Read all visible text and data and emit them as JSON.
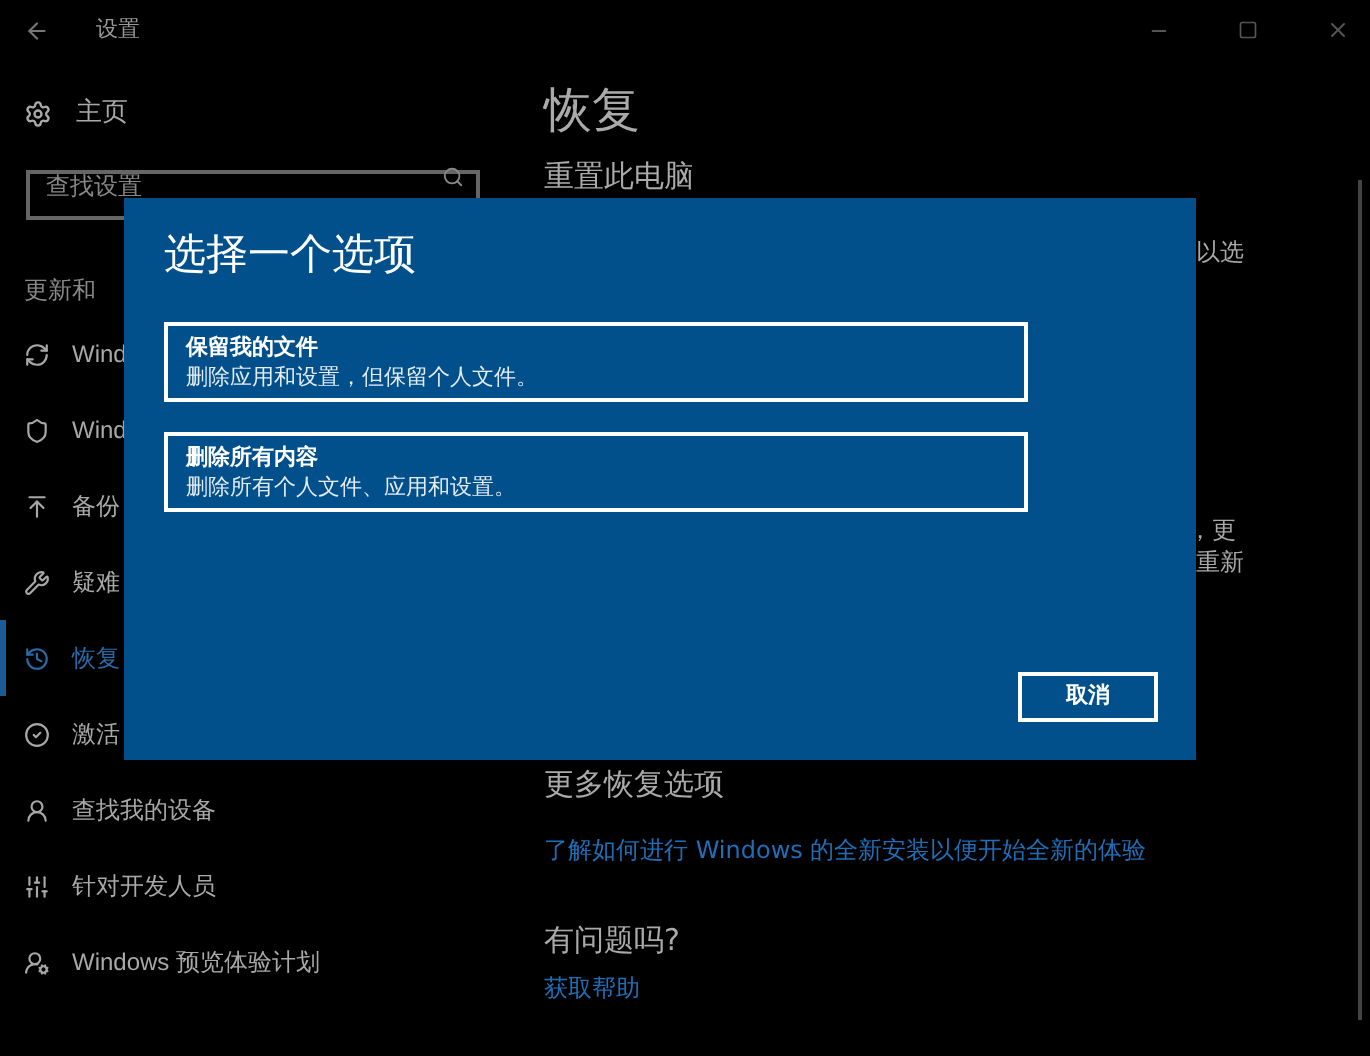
{
  "window": {
    "title": "设置"
  },
  "sidebar": {
    "home": "主页",
    "search": {
      "placeholder": "查找设置"
    },
    "section": "更新和",
    "items": [
      {
        "label": "Wind",
        "selected": false
      },
      {
        "label": "Wind",
        "selected": false
      },
      {
        "label": "备份",
        "selected": false
      },
      {
        "label": "疑难",
        "selected": false
      },
      {
        "label": "恢复",
        "selected": true
      },
      {
        "label": "激活",
        "selected": false
      },
      {
        "label": "查找我的设备",
        "selected": false
      },
      {
        "label": "针对开发人员",
        "selected": false
      },
      {
        "label": "Windows 预览体验计划",
        "selected": false
      }
    ]
  },
  "main": {
    "title": "恢复",
    "reset_heading": "重置此电脑",
    "fragments": [
      "以选",
      "，更",
      "重新"
    ],
    "more_heading": "更多恢复选项",
    "more_link": "了解如何进行 Windows 的全新安装以便开始全新的体验",
    "help_heading": "有问题吗?",
    "help_link": "获取帮助"
  },
  "dialog": {
    "title": "选择一个选项",
    "options": [
      {
        "title": "保留我的文件",
        "description": "删除应用和设置，但保留个人文件。"
      },
      {
        "title": "删除所有内容",
        "description": "删除所有个人文件、应用和设置。"
      }
    ],
    "cancel": "取消"
  }
}
